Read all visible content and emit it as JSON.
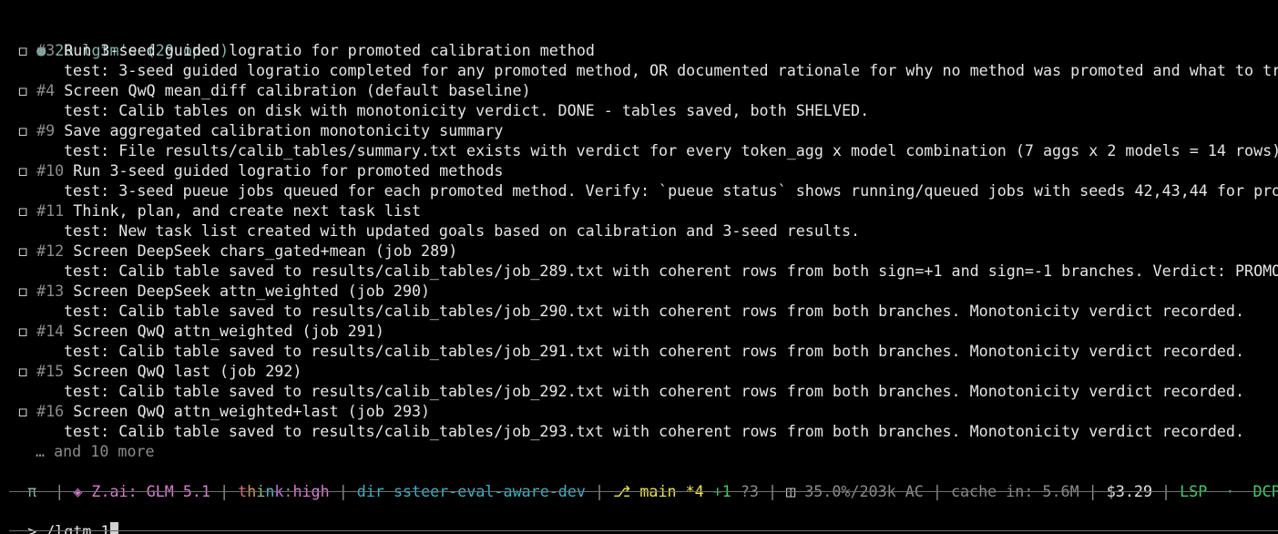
{
  "header": {
    "bullet": "●",
    "title": "20 lgtm's (20 open)"
  },
  "tasks": [
    {
      "id": "#3",
      "title": "Run 3-seed guided logratio for promoted calibration method",
      "test": "test: 3-seed guided logratio completed for any promoted method, OR documented rationale for why no method was promoted and what to try"
    },
    {
      "id": "#4",
      "title": "Screen QwQ mean_diff calibration (default baseline)",
      "test": "test: Calib tables on disk with monotonicity verdict. DONE - tables saved, both SHELVED."
    },
    {
      "id": "#9",
      "title": "Save aggregated calibration monotonicity summary",
      "test": "test: File results/calib_tables/summary.txt exists with verdict for every token_agg x model combination (7 aggs x 2 models = 14 rows)"
    },
    {
      "id": "#10",
      "title": "Run 3-seed guided logratio for promoted methods",
      "test": "test: 3-seed pueue jobs queued for each promoted method. Verify: `pueue status` shows running/queued jobs with seeds 42,43,44 for prom"
    },
    {
      "id": "#11",
      "title": "Think, plan, and create next task list",
      "test": "test: New task list created with updated goals based on calibration and 3-seed results."
    },
    {
      "id": "#12",
      "title": "Screen DeepSeek chars_gated+mean (job 289)",
      "test": "test: Calib table saved to results/calib_tables/job_289.txt with coherent rows from both sign=+1 and sign=-1 branches. Verdict: PROMOT"
    },
    {
      "id": "#13",
      "title": "Screen DeepSeek attn_weighted (job 290)",
      "test": "test: Calib table saved to results/calib_tables/job_290.txt with coherent rows from both branches. Monotonicity verdict recorded."
    },
    {
      "id": "#14",
      "title": "Screen QwQ attn_weighted (job 291)",
      "test": "test: Calib table saved to results/calib_tables/job_291.txt with coherent rows from both branches. Monotonicity verdict recorded."
    },
    {
      "id": "#15",
      "title": "Screen QwQ last (job 292)",
      "test": "test: Calib table saved to results/calib_tables/job_292.txt with coherent rows from both branches. Monotonicity verdict recorded."
    },
    {
      "id": "#16",
      "title": "Screen QwQ attn_weighted+last (job 293)",
      "test": "test: Calib table saved to results/calib_tables/job_293.txt with coherent rows from both branches. Monotonicity verdict recorded."
    }
  ],
  "checkbox_glyph": "◻",
  "more_text": "… and 10 more",
  "status": {
    "pi": "π",
    "sep": "|",
    "provider_icon": "◈",
    "provider": "Z.ai:",
    "model": "GLM 5.1",
    "think_t": "t",
    "think_h": "h",
    "think_i": "i",
    "think_n": "n",
    "think_k": "k",
    "think_colon": ":",
    "think_level": "high",
    "dir_label": "dir",
    "dir_value": "ssteer-eval-aware-dev",
    "branch_icon": "⎇",
    "branch": "main",
    "modified": "*4",
    "added": "+1",
    "untracked": "?3",
    "context_icon": "◫",
    "context": "35.0%/203k AC",
    "cache": "cache in: 5.6M",
    "cost": "$3.29",
    "lsp": "LSP",
    "dot": "·",
    "dcp": "DCP"
  },
  "input": {
    "prompt": ">",
    "value": "/lgtm 1"
  }
}
